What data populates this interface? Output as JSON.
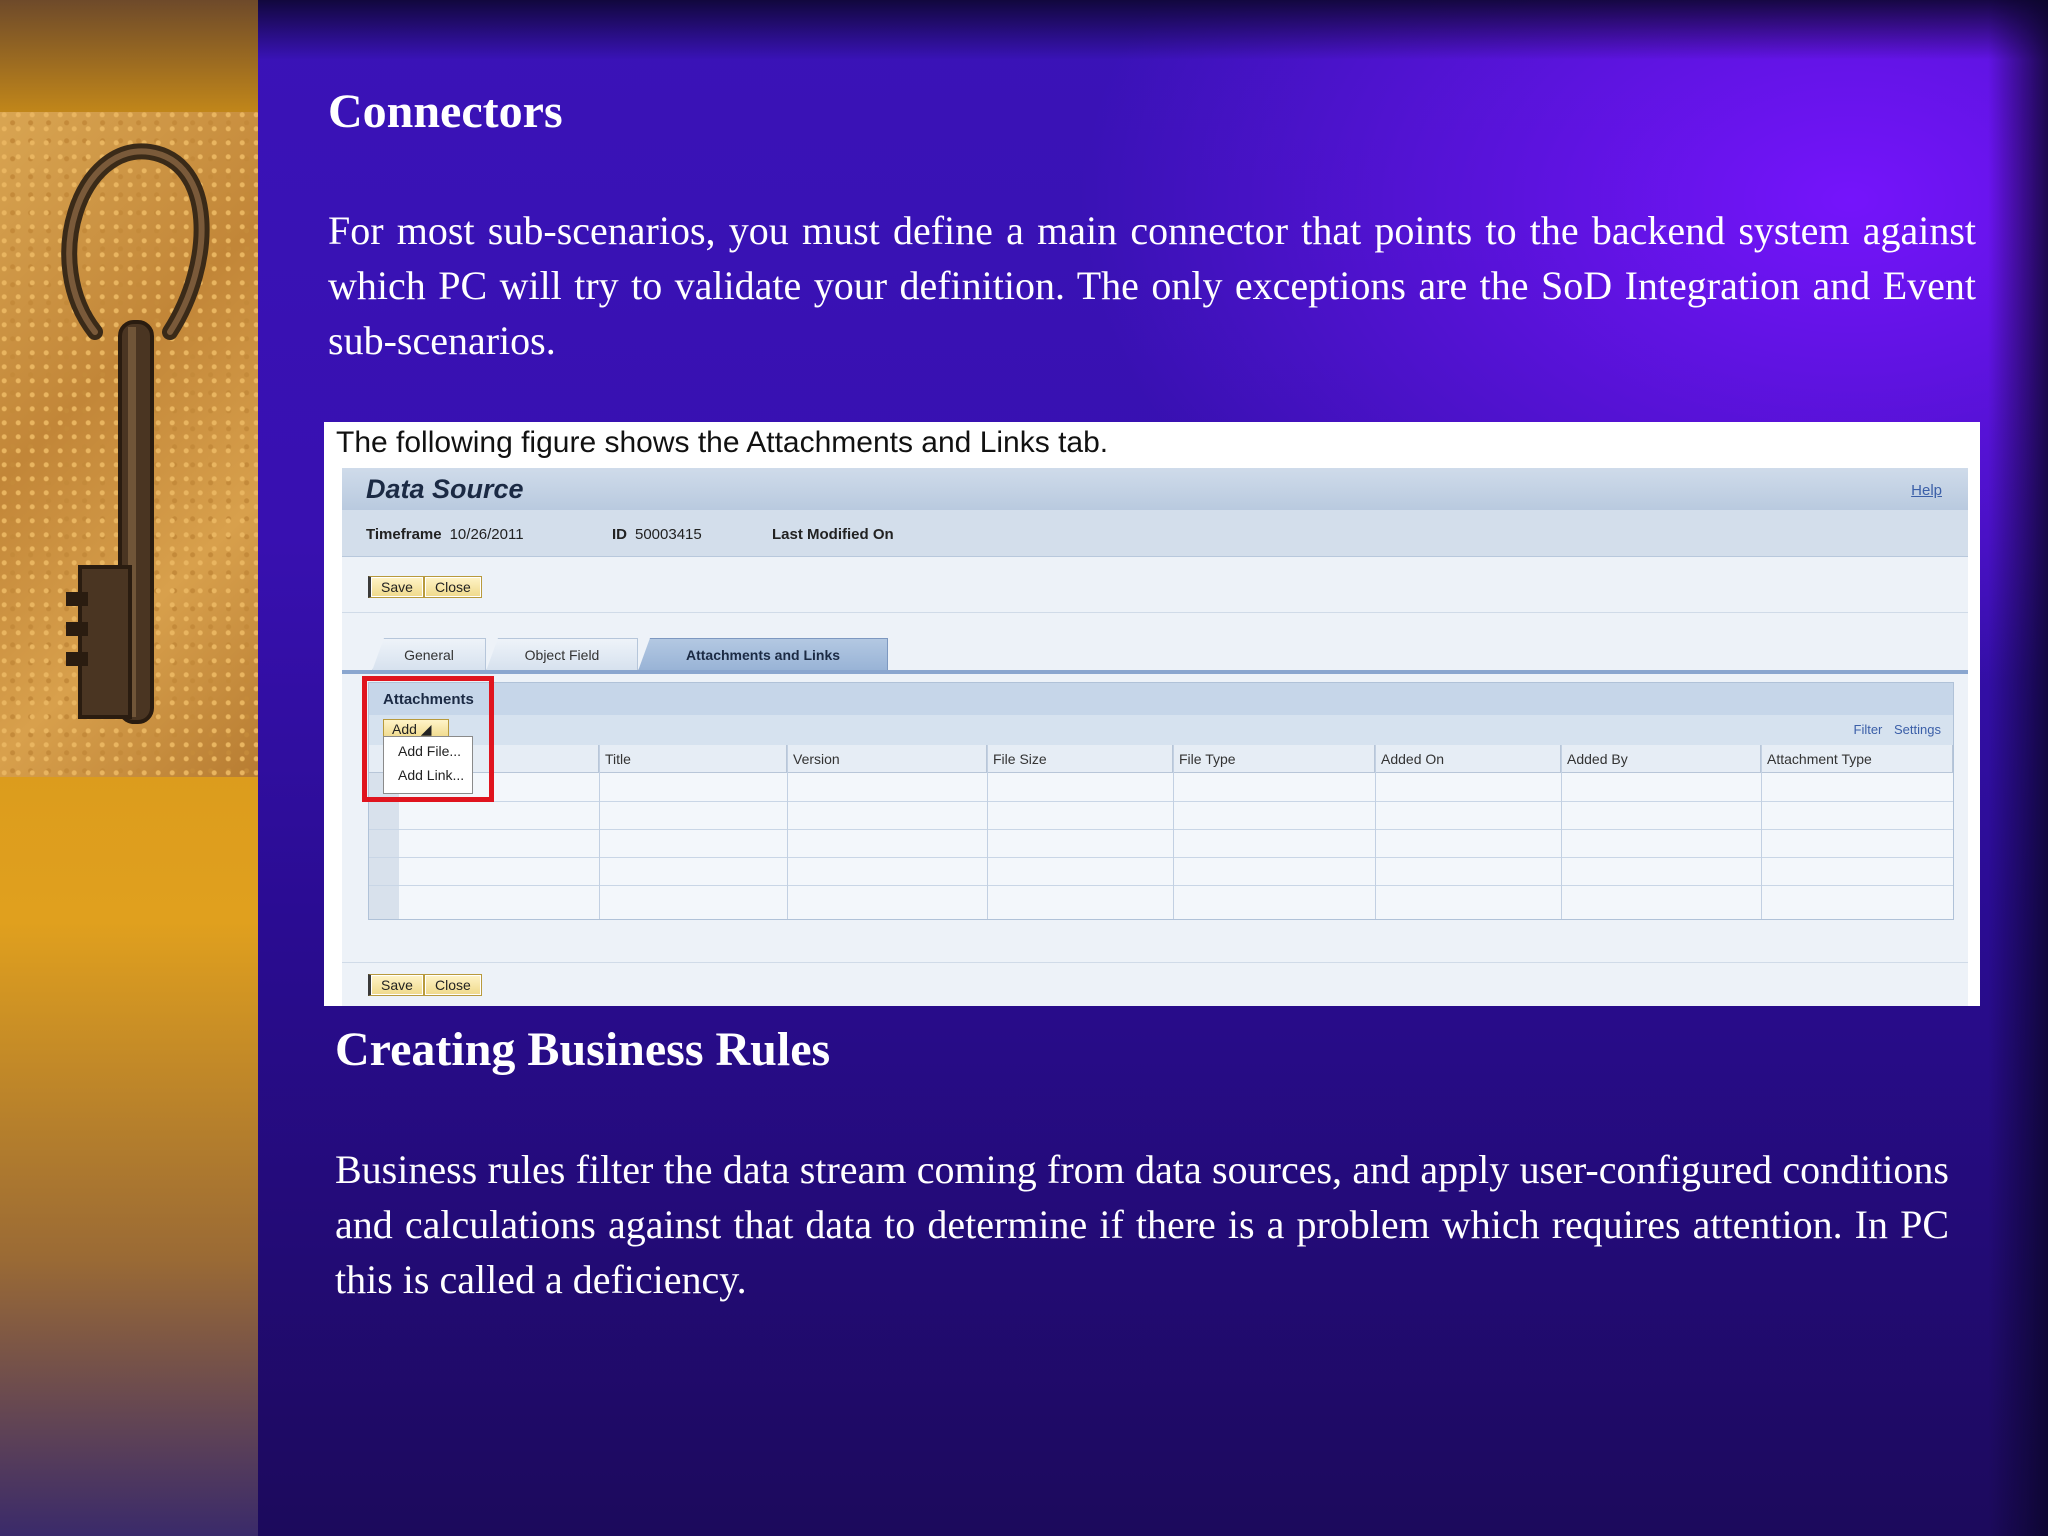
{
  "slide": {
    "heading_1": "Connectors",
    "paragraph_1": "For most sub-scenarios, you must define a main connector that points to the backend system against which PC will try to validate your definition. The only exceptions are the SoD Integration and Event sub-scenarios.",
    "heading_2": "Creating Business Rules",
    "paragraph_2": "Business rules filter the data stream coming from data sources, and apply user-configured conditions and calculations against that data to determine if there is a problem which requires attention. In PC this is called a deficiency."
  },
  "figure": {
    "caption": "The following figure shows the Attachments and Links tab.",
    "window_title": "Data Source",
    "help_link": "Help",
    "meta": {
      "timeframe_label": "Timeframe",
      "timeframe_value": "10/26/2011",
      "id_label": "ID",
      "id_value": "50003415",
      "last_modified_label": "Last Modified On"
    },
    "buttons": {
      "save": "Save",
      "close": "Close"
    },
    "tabs": [
      "General",
      "Object Field",
      "Attachments and Links"
    ],
    "active_tab": "Attachments and Links",
    "attachments": {
      "title": "Attachments",
      "add_button": "Add ◢",
      "menu": [
        "Add File...",
        "Add Link..."
      ],
      "filter": "Filter",
      "settings": "Settings",
      "columns": [
        "Title",
        "Version",
        "File Size",
        "File Type",
        "Added On",
        "Added By",
        "Attachment Type"
      ]
    }
  },
  "colors": {
    "slide_background": "#3a13b8",
    "highlight_box": "#e0141e",
    "left_panel": "#e0a01e"
  },
  "icons": {
    "key_image": "antique-key-photo"
  }
}
